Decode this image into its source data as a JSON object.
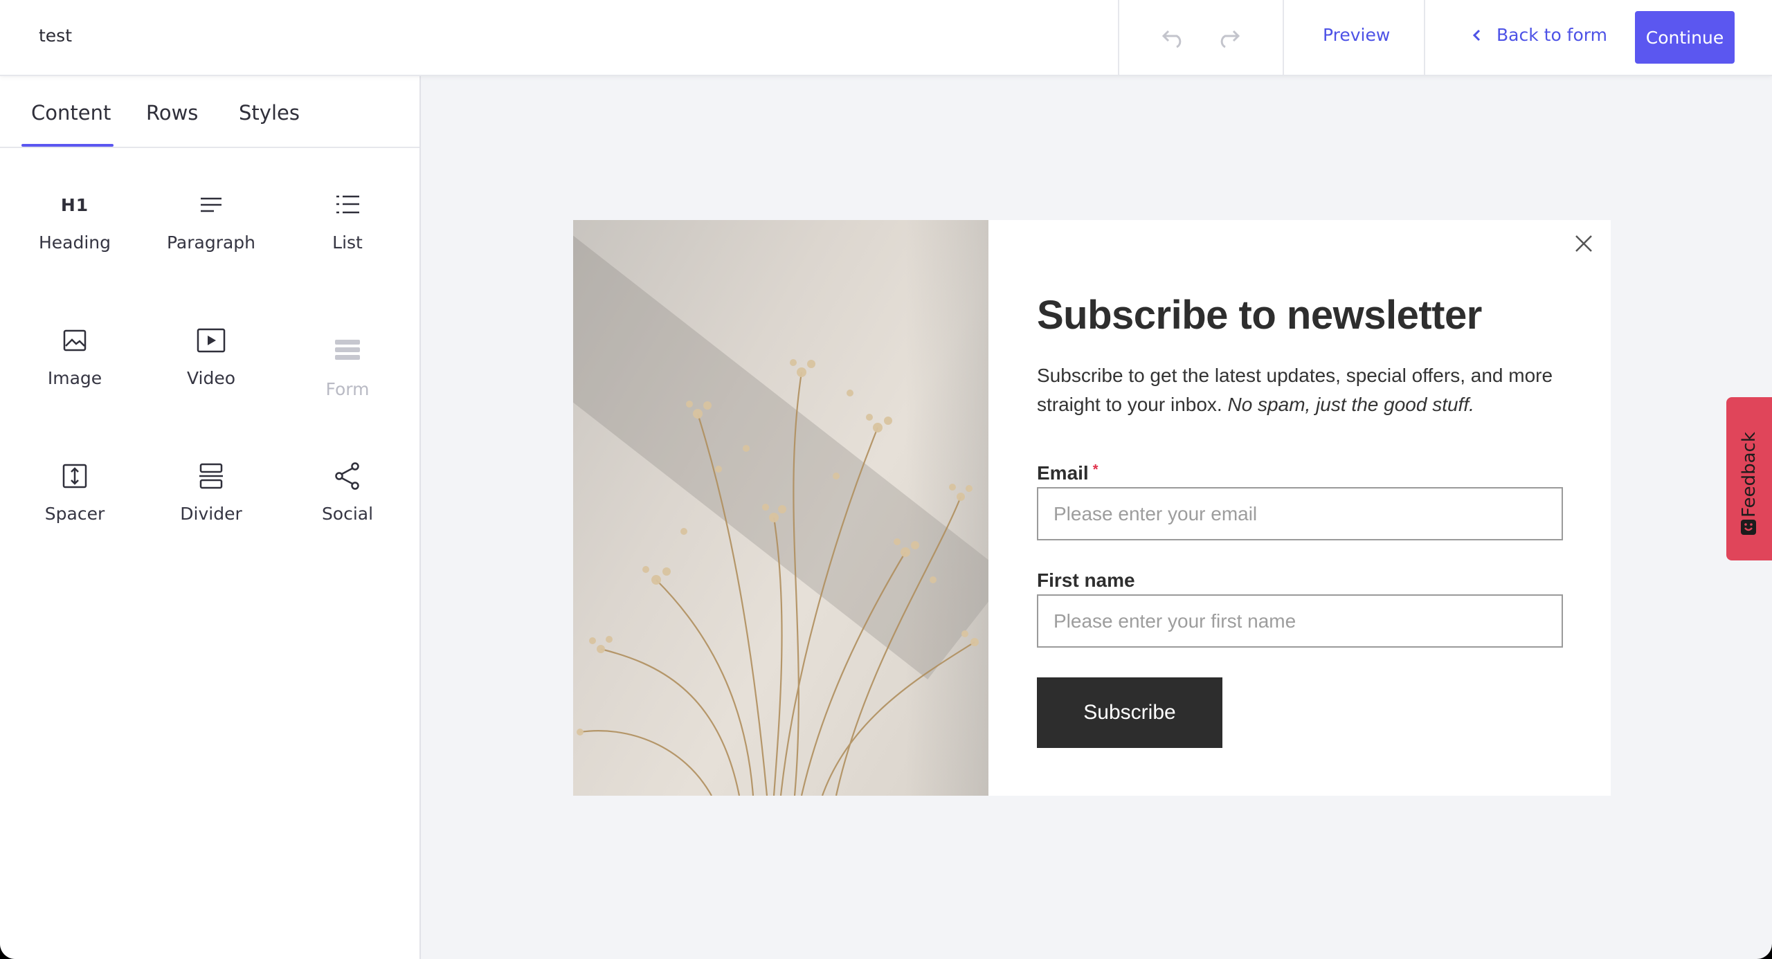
{
  "header": {
    "doc_title": "test",
    "preview_label": "Preview",
    "back_label": "Back to form",
    "continue_label": "Continue"
  },
  "sidebar": {
    "tabs": [
      {
        "label": "Content",
        "active": true
      },
      {
        "label": "Rows",
        "active": false
      },
      {
        "label": "Styles",
        "active": false
      }
    ],
    "blocks": [
      {
        "label": "Heading",
        "icon": "heading-icon",
        "glyph": "H1",
        "disabled": false
      },
      {
        "label": "Paragraph",
        "icon": "paragraph-icon",
        "disabled": false
      },
      {
        "label": "List",
        "icon": "list-icon",
        "disabled": false
      },
      {
        "label": "Image",
        "icon": "image-icon",
        "disabled": false
      },
      {
        "label": "Video",
        "icon": "video-icon",
        "disabled": false
      },
      {
        "label": "Form",
        "icon": "form-icon",
        "disabled": true
      },
      {
        "label": "Spacer",
        "icon": "spacer-icon",
        "disabled": false
      },
      {
        "label": "Divider",
        "icon": "divider-icon",
        "disabled": false
      },
      {
        "label": "Social",
        "icon": "share-icon",
        "disabled": false
      }
    ]
  },
  "modal": {
    "title": "Subscribe to newsletter",
    "description": "Subscribe to get the latest updates, special offers, and more straight to your inbox.",
    "description_italic": "No spam, just the good stuff.",
    "email_label": "Email",
    "email_required_mark": "*",
    "email_placeholder": "Please enter your email",
    "firstname_label": "First name",
    "firstname_placeholder": "Please enter your first name",
    "submit_label": "Subscribe"
  },
  "feedback": {
    "label": "Feedback"
  },
  "colors": {
    "accent": "#5b57f0",
    "link": "#4d52e6",
    "feedback": "#e0455a",
    "button_dark": "#2d2d2d",
    "canvas_bg": "#f3f4f7"
  }
}
